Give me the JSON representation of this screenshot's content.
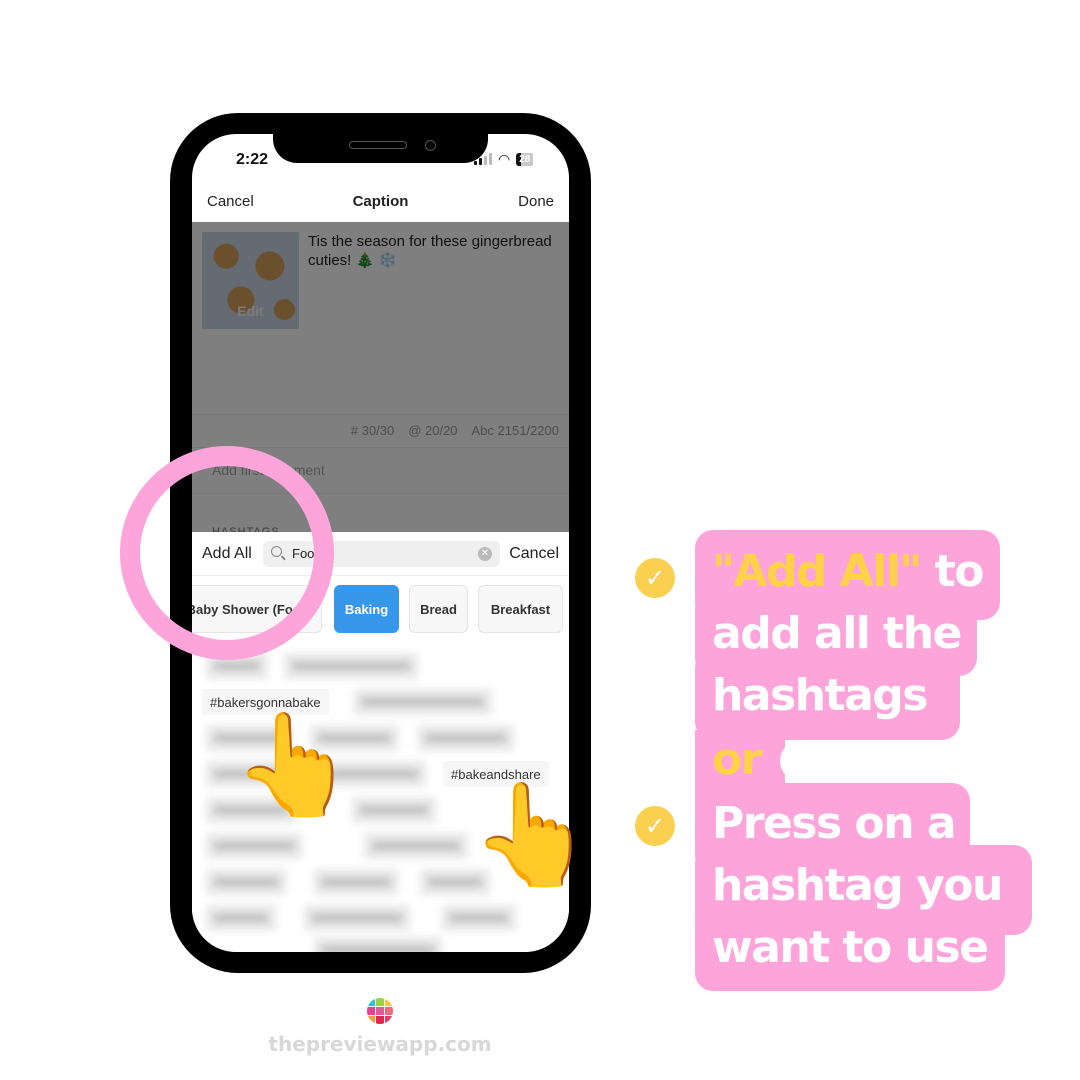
{
  "status_bar": {
    "time": "2:22",
    "battery": "28",
    "wifi_icon": "wifi-icon",
    "signal_icon": "signal-icon"
  },
  "navbar": {
    "cancel": "Cancel",
    "title": "Caption",
    "done": "Done"
  },
  "post": {
    "thumbnail_label": "Edit",
    "caption": "Tis the season for these gingerbread cuties! 🎄 ❄️"
  },
  "counters": {
    "hashtags": "# 30/30",
    "mentions": "@ 20/20",
    "characters": "Abc 2151/2200"
  },
  "first_comment_placeholder": "Add first comment",
  "hashtags_section_label": "HASHTAGS",
  "hashtag_sheet": {
    "add_all": "Add All",
    "search_value": "Foo",
    "cancel": "Cancel",
    "categories": [
      {
        "label": "Baby Shower (Food)",
        "active": false
      },
      {
        "label": "Baking",
        "active": true
      },
      {
        "label": "Bread",
        "active": false
      },
      {
        "label": "Breakfast",
        "active": false
      }
    ],
    "visible_tags": [
      "#bakersgonnabake",
      "#bakeandshare"
    ]
  },
  "callout": {
    "line1_highlight": "\"Add All\"",
    "line1_rest": " to",
    "line2": "add all the",
    "line3": "hashtags",
    "line4": "or",
    "line5": "Press on a",
    "line6": "hashtag you",
    "line7": "want to use"
  },
  "colors": {
    "pink": "#fda4da",
    "yellow": "#fdd248",
    "check_yellow": "#fbcf4f",
    "active_chip_blue": "#3797ea"
  },
  "footer": {
    "url": "thepreviewapp.com"
  }
}
